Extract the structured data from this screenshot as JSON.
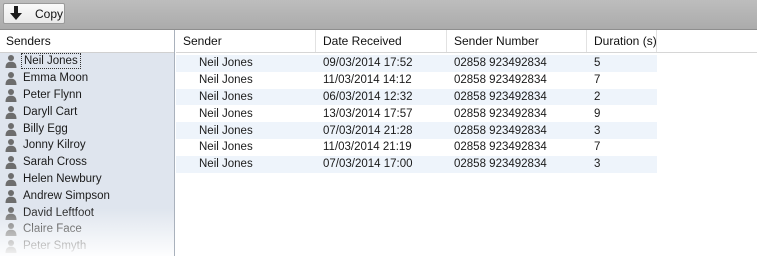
{
  "toolbar": {
    "copy_label": "Copy"
  },
  "senders_panel": {
    "header": "Senders",
    "items": [
      {
        "label": "Neil Jones"
      },
      {
        "label": "Emma Moon"
      },
      {
        "label": "Peter Flynn"
      },
      {
        "label": "Daryll Cart"
      },
      {
        "label": "Billy Egg"
      },
      {
        "label": "Jonny Kilroy"
      },
      {
        "label": "Sarah Cross"
      },
      {
        "label": "Helen Newbury"
      },
      {
        "label": "Andrew Simpson"
      },
      {
        "label": "David Leftfoot"
      },
      {
        "label": "Claire Face"
      },
      {
        "label": "Peter Smyth"
      }
    ],
    "selected": "Neil Jones"
  },
  "messages_table": {
    "columns": [
      "Sender",
      "Date Received",
      "Sender Number",
      "Duration (s)"
    ],
    "rows": [
      [
        "Neil Jones",
        "09/03/2014 17:52",
        "02858 923492834",
        "5"
      ],
      [
        "Neil Jones",
        "11/03/2014 14:12",
        "02858 923492834",
        "7"
      ],
      [
        "Neil Jones",
        "06/03/2014 12:32",
        "02858 923492834",
        "2"
      ],
      [
        "Neil Jones",
        "13/03/2014 17:57",
        "02858 923492834",
        "9"
      ],
      [
        "Neil Jones",
        "07/03/2014 21:28",
        "02858 923492834",
        "3"
      ],
      [
        "Neil Jones",
        "11/03/2014 21:19",
        "02858 923492834",
        "7"
      ],
      [
        "Neil Jones",
        "07/03/2014 17:00",
        "02858 923492834",
        "3"
      ]
    ]
  },
  "icons": {
    "copy": "download-arrow-icon",
    "sender": "person-icon"
  },
  "colors": {
    "toolbar_bg": "#b4b4b4",
    "sidebar_bg": "#dfe5ee",
    "row_alt": "#eef4fb"
  }
}
